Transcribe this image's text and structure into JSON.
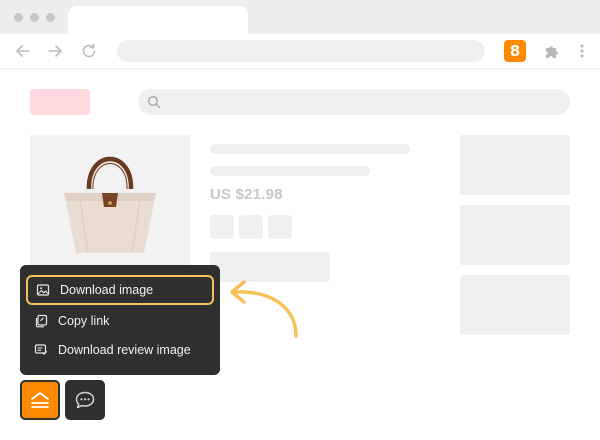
{
  "browser": {
    "extension_badge": "8",
    "extension_badge_color": "#ff8a00"
  },
  "product": {
    "price": "US $21.98"
  },
  "context_menu": {
    "items": [
      {
        "label": "Download image",
        "icon": "image-icon",
        "highlighted": true
      },
      {
        "label": "Copy link",
        "icon": "copy-link-icon",
        "highlighted": false
      },
      {
        "label": "Download review image",
        "icon": "review-image-icon",
        "highlighted": false
      }
    ]
  },
  "floating_buttons": [
    {
      "icon": "home-menu-icon",
      "color": "#ff8a00"
    },
    {
      "icon": "chat-icon",
      "color": "#2f2f2f"
    }
  ],
  "colors": {
    "accent": "#ff8a00",
    "highlight": "#f6c15a",
    "menu_background": "#2f2f2f"
  }
}
